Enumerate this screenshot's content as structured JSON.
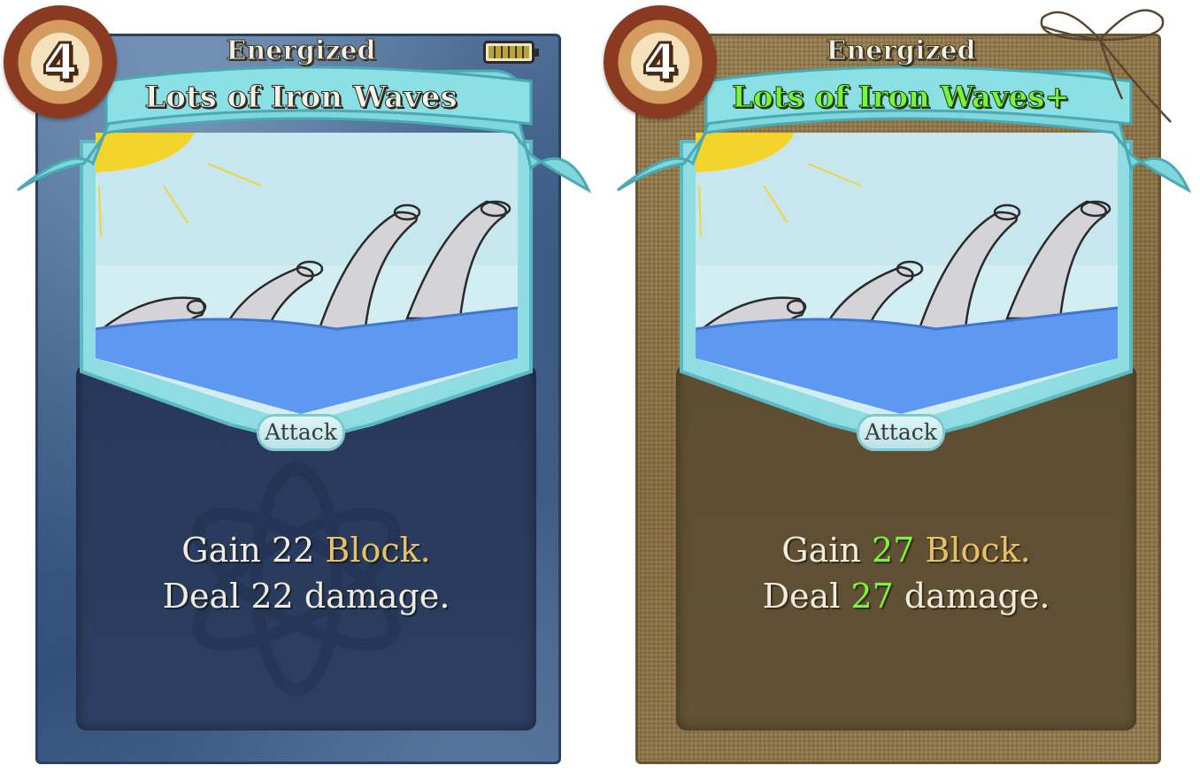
{
  "cards": [
    {
      "energy_cost": "4",
      "tag": "Energized",
      "title": "Lots of Iron Waves",
      "type": "Attack",
      "desc_line1_pre": "Gain ",
      "desc_line1_num": "22",
      "desc_line1_keyword": "Block",
      "desc_line1_post": ".",
      "desc_line2_pre": "Deal ",
      "desc_line2_num": "22",
      "desc_line2_post": " damage.",
      "battery_charge": 1.0,
      "upgraded": false
    },
    {
      "energy_cost": "4",
      "tag": "Energized",
      "title": "Lots of Iron Waves+",
      "type": "Attack",
      "desc_line1_pre": "Gain ",
      "desc_line1_num": "27",
      "desc_line1_keyword": "Block",
      "desc_line1_post": ".",
      "desc_line2_pre": "Deal ",
      "desc_line2_num": "27",
      "desc_line2_post": " damage.",
      "upgraded": true
    }
  ],
  "colors": {
    "keyword": "#e8c165",
    "upgraded": "#7bf53c",
    "banner": "#7fd6dc",
    "water": "#5e98f0"
  }
}
